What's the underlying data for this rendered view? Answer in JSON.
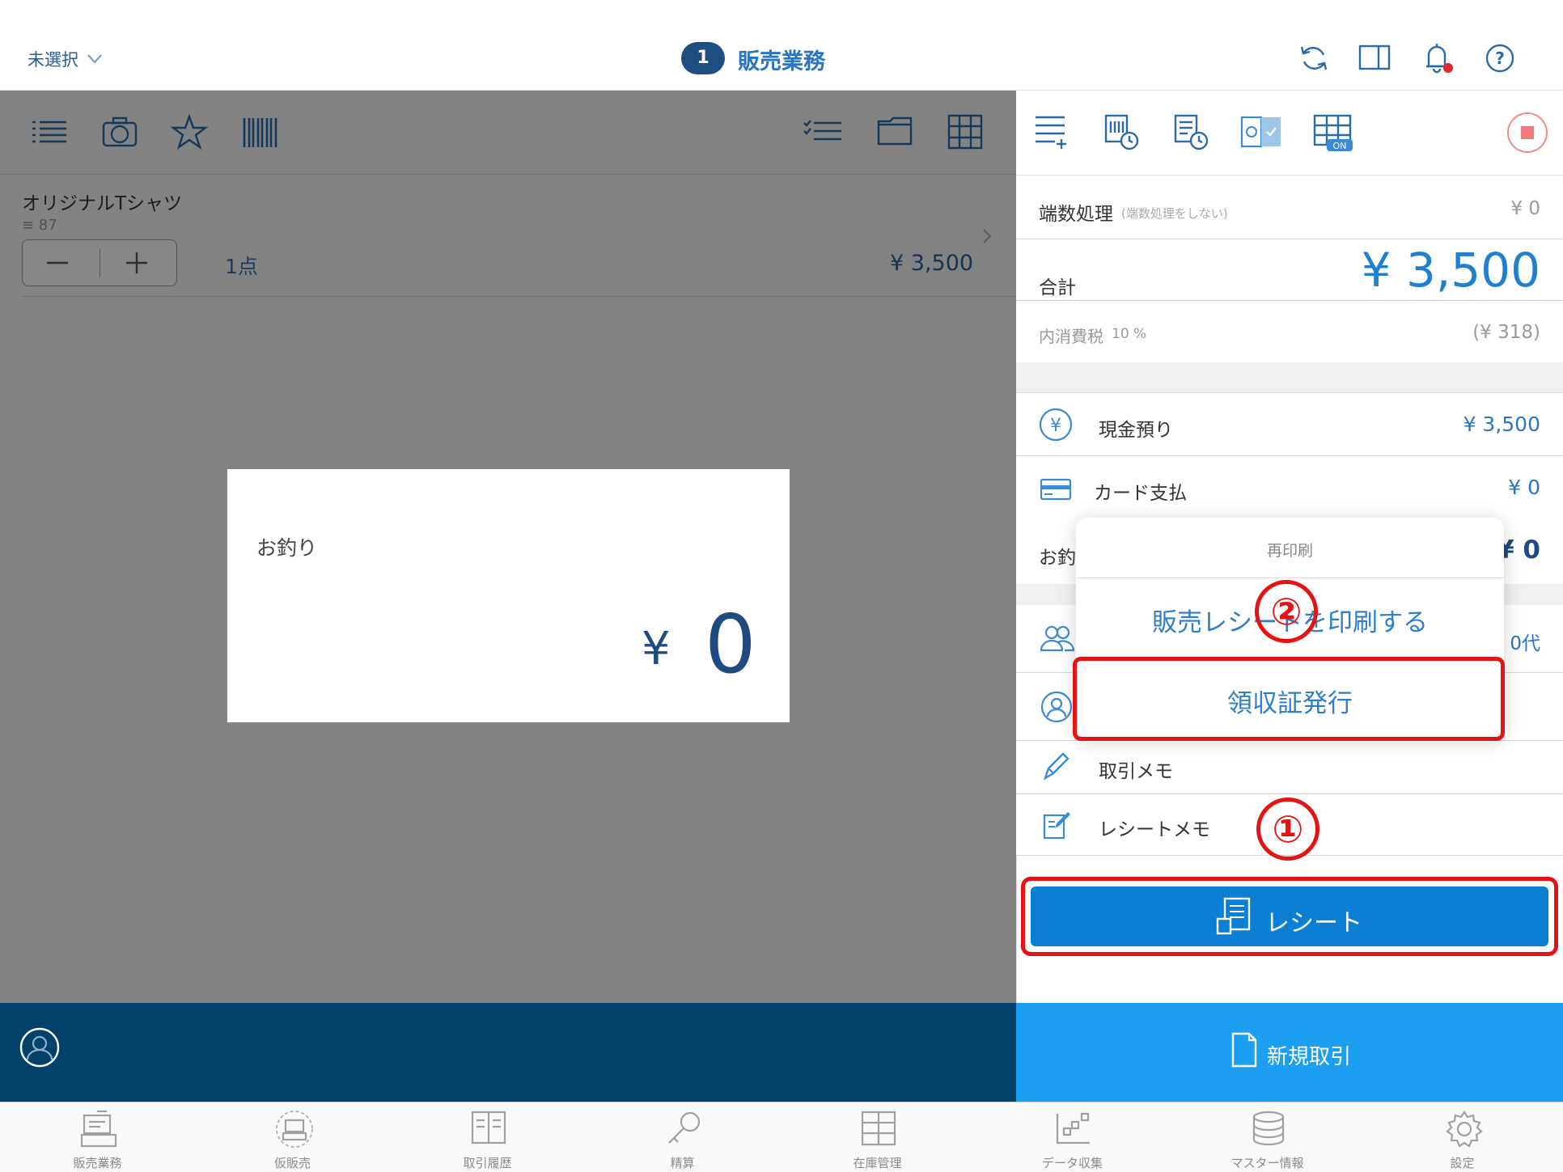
{
  "header": {
    "store_selector": "未選択",
    "register_number": "1",
    "title": "販売業務"
  },
  "cart": {
    "item_name": "オリジナルTシャツ",
    "item_stock": "≡ 87",
    "quantity": "1点",
    "price": "¥ 3,500"
  },
  "change_dialog": {
    "label": "お釣り",
    "currency": "¥",
    "value": "0"
  },
  "summary": {
    "rounding_label": "端数処理",
    "rounding_note": "(端数処理をしない)",
    "rounding_value": "¥ 0",
    "total_label": "合計",
    "total_value": "¥ 3,500",
    "tax_label": "内消費税",
    "tax_rate": "10 %",
    "tax_value": "(¥ 318)"
  },
  "payments": {
    "cash_label": "現金預り",
    "cash_value": "¥ 3,500",
    "card_label": "カード支払",
    "card_value": "¥ 0",
    "change_label": "お釣",
    "change_value": "¥ 0"
  },
  "customer": {
    "age_value": "0代"
  },
  "extras": {
    "memo_label": "取引メモ",
    "receipt_memo_label": "レシートメモ"
  },
  "popup": {
    "title": "再印刷",
    "option_print": "販売レシートを印刷する",
    "option_receipt": "領収証発行"
  },
  "annotations": {
    "step1": "①",
    "step2": "②"
  },
  "actions": {
    "receipt_button": "レシート",
    "new_transaction": "新規取引"
  },
  "tabs": [
    "販売業務",
    "仮販売",
    "取引履歴",
    "精算",
    "在庫管理",
    "データ収集",
    "マスター情報",
    "設定"
  ],
  "colors": {
    "accent": "#2a75c1",
    "primary_button": "#0a7fd4",
    "new_tx": "#1c9ff0",
    "left_bottom": "#01416a",
    "annotation": "#e51313"
  }
}
